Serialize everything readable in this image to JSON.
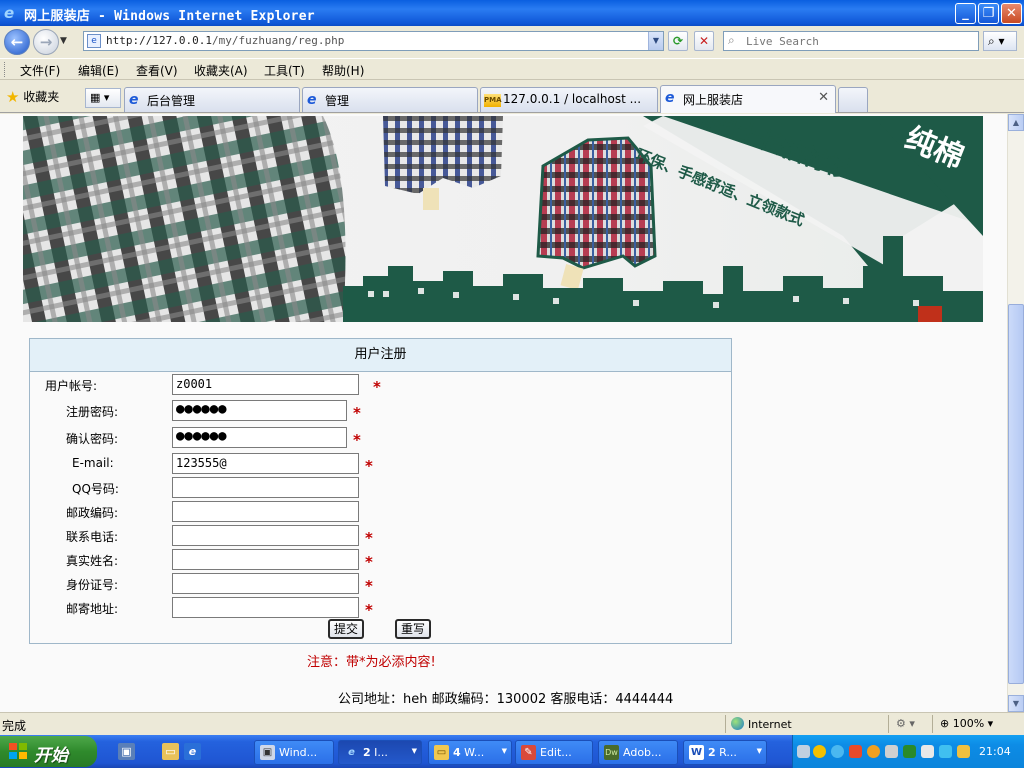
{
  "window": {
    "title": "网上服装店 - Windows Internet Explorer",
    "minimize": "_",
    "restore": "❐",
    "close": "✕"
  },
  "nav": {
    "back_icon": "←",
    "forward_icon": "→",
    "url_prefix": "http://127.0.0.1",
    "url_path": "/my/fuzhuang/reg.php",
    "refresh_icon": "⟳",
    "stop_icon": "✕",
    "search_placeholder": "Live Search",
    "search_go_icon": "⌕"
  },
  "menu": [
    "文件(F)",
    "编辑(E)",
    "查看(V)",
    "收藏夹(A)",
    "工具(T)",
    "帮助(H)"
  ],
  "favorites_label": "收藏夹",
  "tabs": [
    {
      "label": "后台管理"
    },
    {
      "label": "管理"
    },
    {
      "label": "127.0.0.1 / localhost ..."
    },
    {
      "label": "网上服装店"
    }
  ],
  "banner": {
    "slogan": "高休闲男士长袖衬衫",
    "slogan2": "环保、手感舒适、立领款式",
    "corner": "纯棉"
  },
  "form": {
    "title": "用户注册",
    "fields": [
      {
        "label": "用户帐号:",
        "value": "z0001",
        "required": "*"
      },
      {
        "label": "注册密码:",
        "value": "●●●●●●",
        "required": "*"
      },
      {
        "label": "确认密码:",
        "value": "●●●●●●",
        "required": "*"
      },
      {
        "label": "E-mail:",
        "value": "123555@",
        "required": "*"
      },
      {
        "label": "QQ号码:",
        "value": "",
        "required": ""
      },
      {
        "label": "邮政编码:",
        "value": "",
        "required": ""
      },
      {
        "label": "联系电话:",
        "value": "",
        "required": "*"
      },
      {
        "label": "真实姓名:",
        "value": "",
        "required": "*"
      },
      {
        "label": "身份证号:",
        "value": "",
        "required": "*"
      },
      {
        "label": "邮寄地址:",
        "value": "",
        "required": "*"
      }
    ],
    "submit": "提交",
    "reset": "重写"
  },
  "notice": "注意：带*为必添内容!",
  "footer": "公司地址：heh  邮政编码：130002 客服电话：4444444",
  "status": {
    "text": "完成",
    "zone": "Internet",
    "zoom": "100%"
  },
  "taskbar": {
    "start": "开始",
    "items": [
      {
        "count": "",
        "label": "Wind..."
      },
      {
        "count": "2",
        "label": "I..."
      },
      {
        "count": "4",
        "label": "W..."
      },
      {
        "count": "",
        "label": "Edit..."
      },
      {
        "count": "",
        "label": "Adob..."
      },
      {
        "count": "2",
        "label": "R..."
      }
    ],
    "clock": "21:04"
  },
  "colors": {
    "required": "#c00000",
    "form_header_bg": "#e3f0f8",
    "banner_green": "#1e5a47"
  }
}
